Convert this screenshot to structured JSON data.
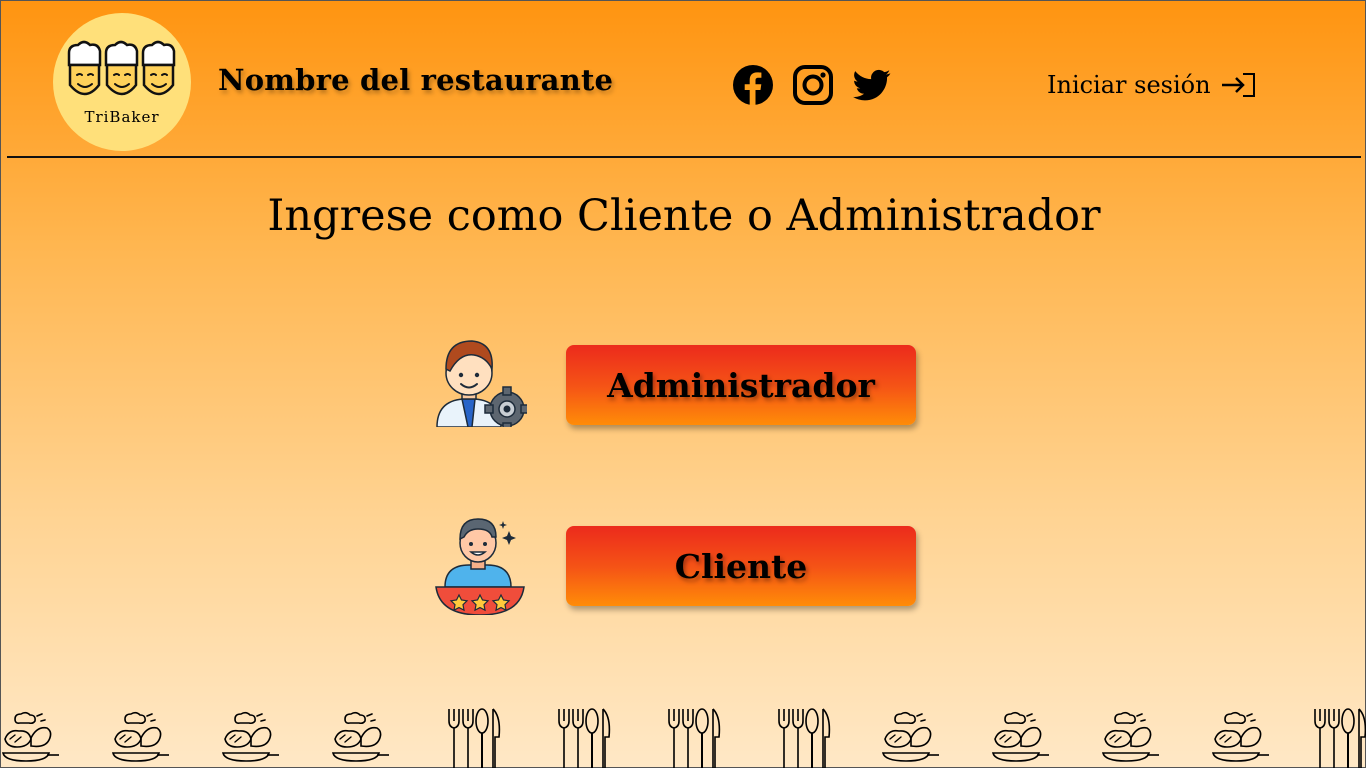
{
  "header": {
    "logo_text": "TriBaker",
    "restaurant_name": "Nombre del restaurante",
    "social_links": [
      {
        "name": "facebook",
        "icon": "facebook-icon"
      },
      {
        "name": "instagram",
        "icon": "instagram-icon"
      },
      {
        "name": "twitter",
        "icon": "twitter-icon"
      }
    ],
    "login_label": "Iniciar sesión",
    "login_icon": "login-arrow-icon"
  },
  "main": {
    "heading": "Ingrese como Cliente o Administrador",
    "roles": [
      {
        "label": "Administrador",
        "icon": "admin-avatar-icon"
      },
      {
        "label": "Cliente",
        "icon": "client-avatar-icon"
      }
    ]
  },
  "footer": {
    "pattern": [
      "chef-dish-icon",
      "chef-dish-icon",
      "chef-dish-icon",
      "chef-dish-icon",
      "cutlery-icon",
      "cutlery-icon",
      "cutlery-icon",
      "cutlery-icon",
      "chef-dish-icon",
      "chef-dish-icon",
      "chef-dish-icon",
      "chef-dish-icon",
      "cutlery-icon"
    ]
  },
  "colors": {
    "header_orange": "#ff9410",
    "background_bottom": "#ffe8c6",
    "logo_circle": "#ffe07a",
    "button_top": "#ec2a1c",
    "button_bottom": "#ff8c08"
  }
}
